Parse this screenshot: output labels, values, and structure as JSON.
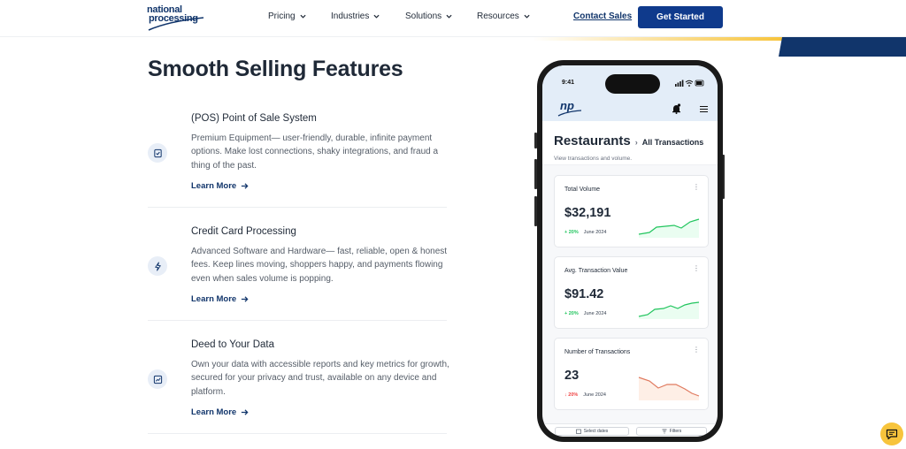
{
  "header": {
    "logo_line1": "national",
    "logo_line2": "processing",
    "nav": [
      {
        "label": "Pricing"
      },
      {
        "label": "Industries"
      },
      {
        "label": "Solutions"
      },
      {
        "label": "Resources"
      }
    ],
    "contact_label": "Contact Sales",
    "cta_label": "Get Started"
  },
  "main": {
    "title": "Smooth Selling Features",
    "features": [
      {
        "title": "(POS) Point of Sale System",
        "description": "Premium Equipment— user-friendly, durable, infinite payment options. Make lost connections, shaky integrations, and fraud a thing of the past.",
        "link": "Learn More",
        "icon": "checklist-icon"
      },
      {
        "title": "Credit Card Processing",
        "description": "Advanced Software and Hardware— fast, reliable, open & honest fees. Keep lines moving, shoppers happy, and payments flowing even when sales volume is popping.",
        "link": "Learn More",
        "icon": "lightning-icon"
      },
      {
        "title": "Deed to Your Data",
        "description": "Own your data with accessible reports and key metrics for growth, secured for your privacy and trust, available on any device and platform.",
        "link": "Learn More",
        "icon": "chart-icon"
      }
    ]
  },
  "phone": {
    "time": "9:41",
    "app_logo": "np",
    "title": "Restaurants",
    "separator": "›",
    "subtitle": "All Transactions",
    "description": "View transactions and volume.",
    "cards": [
      {
        "label": "Total Volume",
        "value": "$32,191",
        "change": "+ 20%",
        "period": "June 2024",
        "trend": "up"
      },
      {
        "label": "Avg. Transaction Value",
        "value": "$91.42",
        "change": "+ 20%",
        "period": "June 2024",
        "trend": "up"
      },
      {
        "label": "Number of Transactions",
        "value": "23",
        "change": "↓ 20%",
        "period": "June 2024",
        "trend": "down"
      }
    ],
    "select_dates": "Select dates",
    "filters": "Filters"
  },
  "colors": {
    "brand_navy": "#11356b",
    "cta_blue": "#0f3a8c",
    "accent_yellow": "#f7c43c",
    "positive_green": "#22c55e",
    "negative_red": "#ef4444"
  }
}
